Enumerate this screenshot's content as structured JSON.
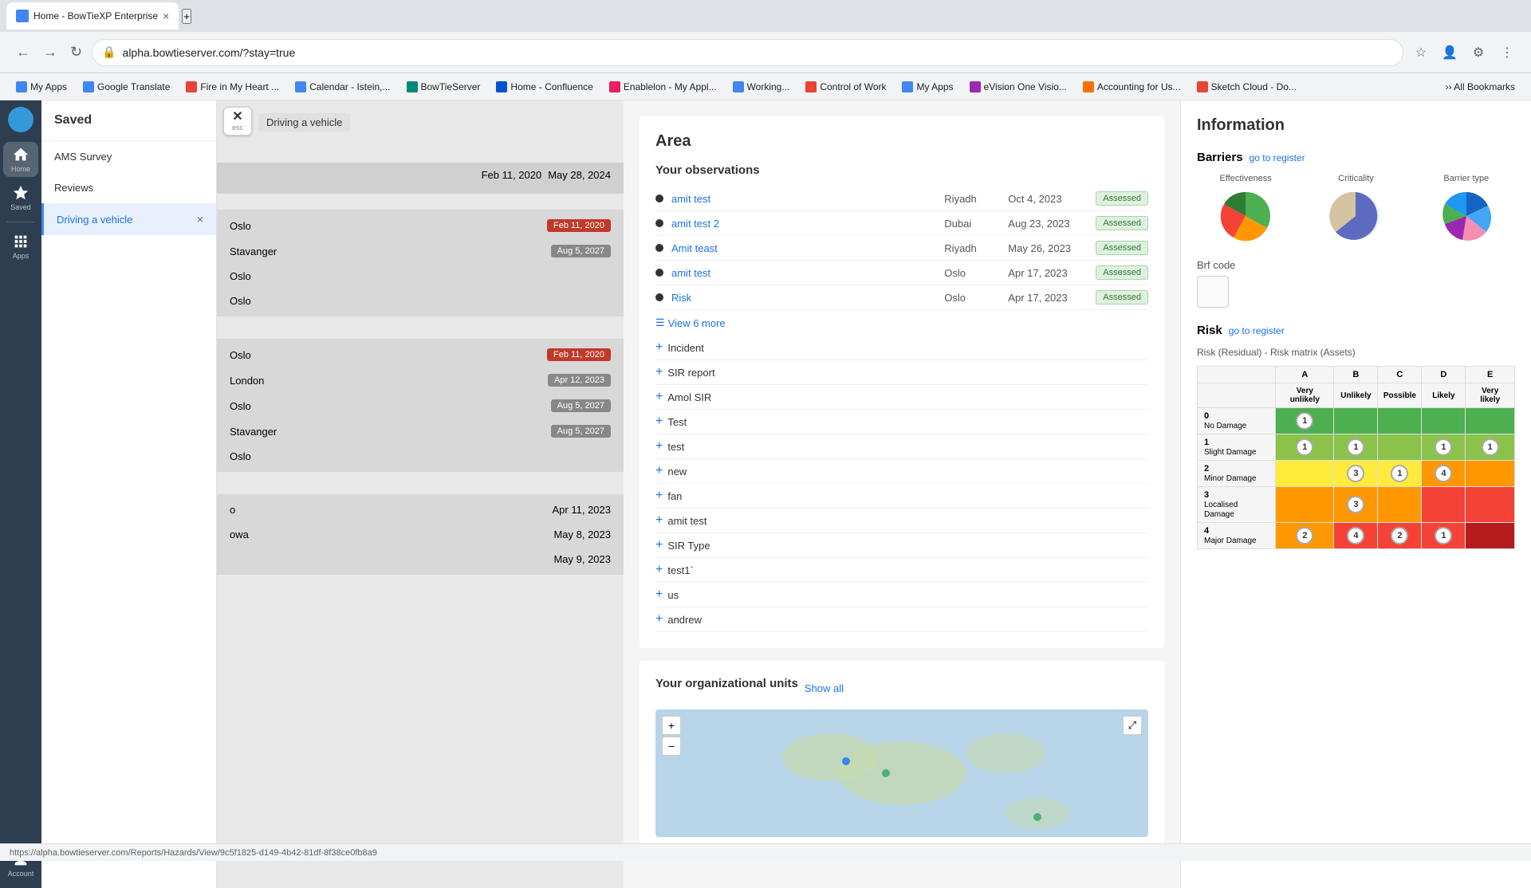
{
  "browser": {
    "tab": {
      "title": "Home - BowTieXP Enterprise",
      "favicon_color": "#4285f4"
    },
    "address": "alpha.bowtieserver.com/?stay=true",
    "bookmarks": [
      {
        "label": "My Apps",
        "color": "#4285f4",
        "type": "ms"
      },
      {
        "label": "Google Translate",
        "color": "#4285f4",
        "type": "g"
      },
      {
        "label": "Fire in My Heart ...",
        "color": "#ea4335",
        "type": "fire"
      },
      {
        "label": "Calendar - Istein,...",
        "color": "#4285f4",
        "type": "cal"
      },
      {
        "label": "BowTieServer",
        "color": "#00897b",
        "type": "bt"
      },
      {
        "label": "Home - Confluence",
        "color": "#0052cc",
        "type": "conf"
      },
      {
        "label": "Enablelon - My Appl...",
        "color": "#e91e63",
        "type": "en"
      },
      {
        "label": "Working...",
        "color": "#4285f4",
        "type": "ms"
      },
      {
        "label": "Control of Work",
        "color": "#ea4335",
        "type": "ms"
      },
      {
        "label": "My Apps",
        "color": "#4285f4",
        "type": "ms"
      },
      {
        "label": "eVision One Visio...",
        "color": "#9c27b0",
        "type": "ev"
      },
      {
        "label": "Accounting for Us...",
        "color": "#ff6f00",
        "type": "ac"
      },
      {
        "label": "Sketch Cloud - Do...",
        "color": "#ea4335",
        "type": "sk"
      }
    ]
  },
  "sidebar_icons": {
    "logo_label": "",
    "items": [
      {
        "label": "Home",
        "icon": "home"
      },
      {
        "label": "Saved",
        "icon": "star"
      },
      {
        "label": "Apps",
        "icon": "apps"
      },
      {
        "label": "Account",
        "icon": "account"
      }
    ]
  },
  "saved_panel": {
    "title": "Saved",
    "items": [
      {
        "label": "AMS Survey",
        "active": false
      },
      {
        "label": "Reviews",
        "active": false
      },
      {
        "label": "Driving a vehicle",
        "active": true
      }
    ]
  },
  "driving_label": "Driving a vehicle",
  "dates": {
    "feb_2020": "Feb 11, 2020",
    "may_2024": "May 28, 2024",
    "feb_2020b": "Feb 11, 2020",
    "aug_2027": "Aug 5, 2027",
    "feb_2020c": "Feb 11, 2020",
    "apr_2023": "Apr 12, 2023",
    "aug_2027b": "Aug 5, 2027",
    "aug_2027c": "Aug 5, 2027",
    "apr_2023b": "Apr 11, 2023",
    "may_2023": "May 8, 2023",
    "may_2023b": "May 9, 2023"
  },
  "locations": {
    "oslo": "Oslo",
    "stavanger": "Stavanger",
    "london": "London"
  },
  "area": {
    "title": "Area",
    "observations_label": "Your observations",
    "observations": [
      {
        "name": "amit test",
        "location": "Riyadh",
        "date": "Oct 4, 2023",
        "status": "Assessed"
      },
      {
        "name": "amit test 2",
        "location": "Dubai",
        "date": "Aug 23, 2023",
        "status": "Assessed"
      },
      {
        "name": "Amit teast",
        "location": "Riyadh",
        "date": "May 26, 2023",
        "status": "Assessed"
      },
      {
        "name": "amit test",
        "location": "Oslo",
        "date": "Apr 17, 2023",
        "status": "Assessed"
      },
      {
        "name": "Risk",
        "location": "Oslo",
        "date": "Apr 17, 2023",
        "status": "Assessed"
      }
    ],
    "view_more": "View 6 more",
    "expand_items": [
      "Incident",
      "SIR report",
      "Amol SIR",
      "Test",
      "test",
      "new",
      "fan",
      "amit test",
      "SIR Type",
      "test1`",
      "us",
      "andrew"
    ],
    "org_units_label": "Your organizational units",
    "show_all": "Show all"
  },
  "information": {
    "title": "Information",
    "barriers": {
      "title": "Barriers",
      "go_register": "go to register",
      "charts": [
        {
          "label": "Effectiveness"
        },
        {
          "label": "Criticality"
        },
        {
          "label": "Barrier type"
        }
      ],
      "brf_code_label": "Brf code"
    },
    "risk": {
      "title": "Risk",
      "go_register": "go to register",
      "subtitle": "Risk (Residual) - Risk matrix (Assets)",
      "columns": [
        "A",
        "B",
        "C",
        "D",
        "E"
      ],
      "col_labels": [
        "Very unlikely",
        "Unlikely",
        "Possible",
        "Likely",
        "Very likely"
      ],
      "rows": [
        {
          "num": "0",
          "label": "No Damage",
          "cells": [
            {
              "val": "1",
              "class": "cell-green"
            },
            {
              "val": "",
              "class": "cell-green"
            },
            {
              "val": "",
              "class": "cell-green"
            },
            {
              "val": "",
              "class": "cell-green"
            },
            {
              "val": "",
              "class": "cell-green"
            }
          ]
        },
        {
          "num": "1",
          "label": "Slight Damage",
          "cells": [
            {
              "val": "1",
              "class": "cell-light-green"
            },
            {
              "val": "1",
              "class": "cell-light-green"
            },
            {
              "val": "",
              "class": "cell-light-green"
            },
            {
              "val": "1",
              "class": "cell-light-green"
            },
            {
              "val": "1",
              "class": "cell-light-green"
            }
          ]
        },
        {
          "num": "2",
          "label": "Minor Damage",
          "cells": [
            {
              "val": "",
              "class": "cell-yellow"
            },
            {
              "val": "3",
              "class": "cell-yellow"
            },
            {
              "val": "1",
              "class": "cell-yellow"
            },
            {
              "val": "4",
              "class": "cell-orange"
            },
            {
              "val": "",
              "class": "cell-orange"
            }
          ]
        },
        {
          "num": "3",
          "label": "Localised Damage",
          "cells": [
            {
              "val": "",
              "class": "cell-orange"
            },
            {
              "val": "3",
              "class": "cell-orange"
            },
            {
              "val": "",
              "class": "cell-orange"
            },
            {
              "val": "",
              "class": "cell-red"
            },
            {
              "val": "",
              "class": "cell-red"
            }
          ]
        },
        {
          "num": "4",
          "label": "Major Damage",
          "cells": [
            {
              "val": "2",
              "class": "cell-orange"
            },
            {
              "val": "4",
              "class": "cell-red"
            },
            {
              "val": "2",
              "class": "cell-red"
            },
            {
              "val": "1",
              "class": "cell-red"
            },
            {
              "val": "",
              "class": "cell-dark-red"
            }
          ]
        }
      ]
    }
  }
}
